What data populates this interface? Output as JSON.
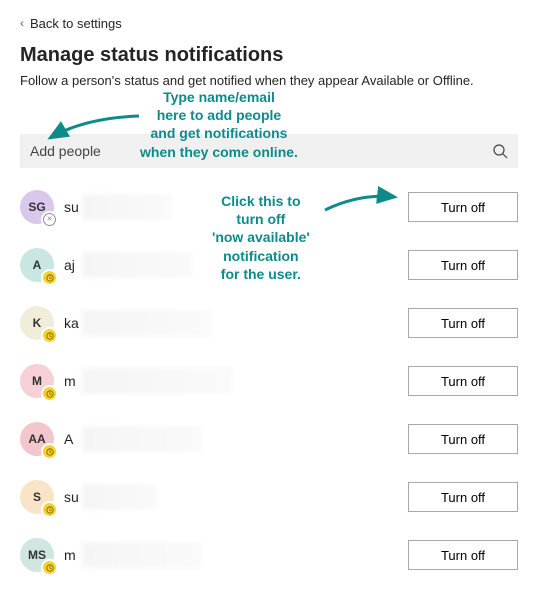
{
  "back_link": "Back to settings",
  "title": "Manage status notifications",
  "description": "Follow a person's status and get notified when they appear Available or Offline.",
  "search": {
    "placeholder": "Add people"
  },
  "turn_off_label": "Turn off",
  "people": [
    {
      "initials": "SG",
      "avatar_color": "#d9c8ec",
      "presence": "offline",
      "name_prefix": "su",
      "blur_w": 90
    },
    {
      "initials": "A",
      "avatar_color": "#c9e7e2",
      "presence": "away",
      "name_prefix": "aj",
      "blur_w": 110
    },
    {
      "initials": "K",
      "avatar_color": "#f0eeda",
      "presence": "away",
      "name_prefix": "ka",
      "blur_w": 130
    },
    {
      "initials": "M",
      "avatar_color": "#f6d0d6",
      "presence": "away",
      "name_prefix": "m",
      "blur_w": 150
    },
    {
      "initials": "AA",
      "avatar_color": "#f3c6cc",
      "presence": "away",
      "name_prefix": "A",
      "blur_w": 120
    },
    {
      "initials": "S",
      "avatar_color": "#f9e4c8",
      "presence": "away",
      "name_prefix": "su",
      "blur_w": 75
    },
    {
      "initials": "MS",
      "avatar_color": "#cfe6e1",
      "presence": "away",
      "name_prefix": "m",
      "blur_w": 120
    }
  ],
  "annotations": {
    "top": "Type name/email\nhere to add people\nand get notifications\nwhen they come online.",
    "mid": "Click this to\nturn off\n'now available'\nnotification\nfor the user."
  }
}
